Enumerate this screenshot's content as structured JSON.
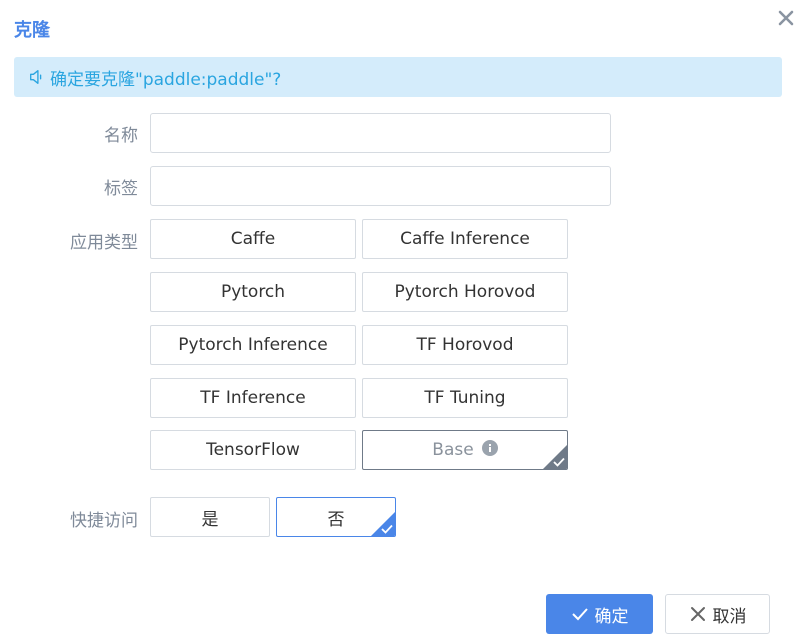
{
  "dialog": {
    "title": "克隆",
    "close_icon": "close-icon"
  },
  "notice": {
    "icon": "speaker-icon",
    "text": "确定要克隆\"paddle:paddle\"?"
  },
  "form": {
    "name_label": "名称",
    "name_value": "",
    "tag_label": "标签",
    "tag_value": "",
    "app_type_label": "应用类型",
    "app_types": [
      {
        "label": "Caffe"
      },
      {
        "label": "Caffe Inference"
      },
      {
        "label": "Pytorch"
      },
      {
        "label": "Pytorch Horovod"
      },
      {
        "label": "Pytorch Inference"
      },
      {
        "label": "TF Horovod"
      },
      {
        "label": "TF Inference"
      },
      {
        "label": "TF Tuning"
      },
      {
        "label": "TensorFlow"
      },
      {
        "label": "Base",
        "selected": true,
        "info_icon": "info-icon"
      }
    ],
    "quick_access_label": "快捷访问",
    "quick_access_options": [
      {
        "label": "是"
      },
      {
        "label": "否",
        "selected": true
      }
    ]
  },
  "footer": {
    "ok_label": "确定",
    "cancel_label": "取消"
  },
  "colors": {
    "accent": "#4a86e8",
    "notice_bg": "#d4ecfb",
    "notice_text": "#2aa5e0",
    "selected_gray": "#6f7a88"
  }
}
